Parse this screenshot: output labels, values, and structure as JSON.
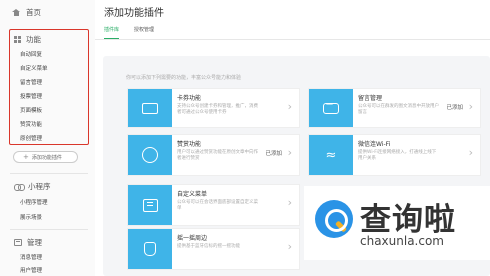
{
  "sidebar": {
    "home_label": "首页",
    "features_label": "功能",
    "features_items": [
      "自动回复",
      "自定义菜单",
      "留言管理",
      "投票管理",
      "页面模板",
      "赞赏功能",
      "原创管理"
    ],
    "add_plugin_label": "添加功能插件",
    "miniprogram_label": "小程序",
    "miniprogram_items": [
      "小程序管理",
      "展示场景"
    ],
    "manage_label": "管理",
    "manage_items": [
      "消息管理",
      "用户管理"
    ]
  },
  "main": {
    "title": "添加功能插件",
    "tabs": [
      {
        "label": "插件库",
        "active": true
      },
      {
        "label": "授权管理",
        "active": false
      }
    ],
    "hint": "你可以添加下列需要的功能，丰富公众号能力和体验",
    "cards": [
      {
        "name": "卡券功能",
        "desc": "支持公众号创建卡券和管理，推广，消费者可通过公众号使用卡券",
        "added": "",
        "color": "#3fb4e8",
        "icon": "wallet-icon"
      },
      {
        "name": "留言管理",
        "desc": "公众号可以在群发的图文消息中开放用户留言",
        "added": "已添加",
        "color": "#3fb4e8",
        "icon": "chat-icon"
      },
      {
        "name": "赞赏功能",
        "desc": "用户可以通过赞赏功能在原创文章中向作者进行赞赏",
        "added": "已添加",
        "color": "#3fb4e8",
        "icon": "coin-icon"
      },
      {
        "name": "微信连Wi-Fi",
        "desc": "提供Wi-Fi连接网络接入，打通线上线下用户关系",
        "added": "",
        "color": "#3fb4e8",
        "icon": "wifi-icon"
      },
      {
        "name": "自定义菜单",
        "desc": "公众号可以在会话界面底部设置自定义菜单",
        "added": "",
        "color": "#3fb4e8",
        "icon": "menu-icon"
      },
      {
        "name": "摇一摇周边",
        "desc": "提供基于蓝牙信标的摇一摇功能",
        "added": "",
        "color": "#3fb4e8",
        "icon": "hand-icon"
      }
    ]
  },
  "watermark": {
    "text": "查询啦",
    "url": "chaxunla.com"
  }
}
